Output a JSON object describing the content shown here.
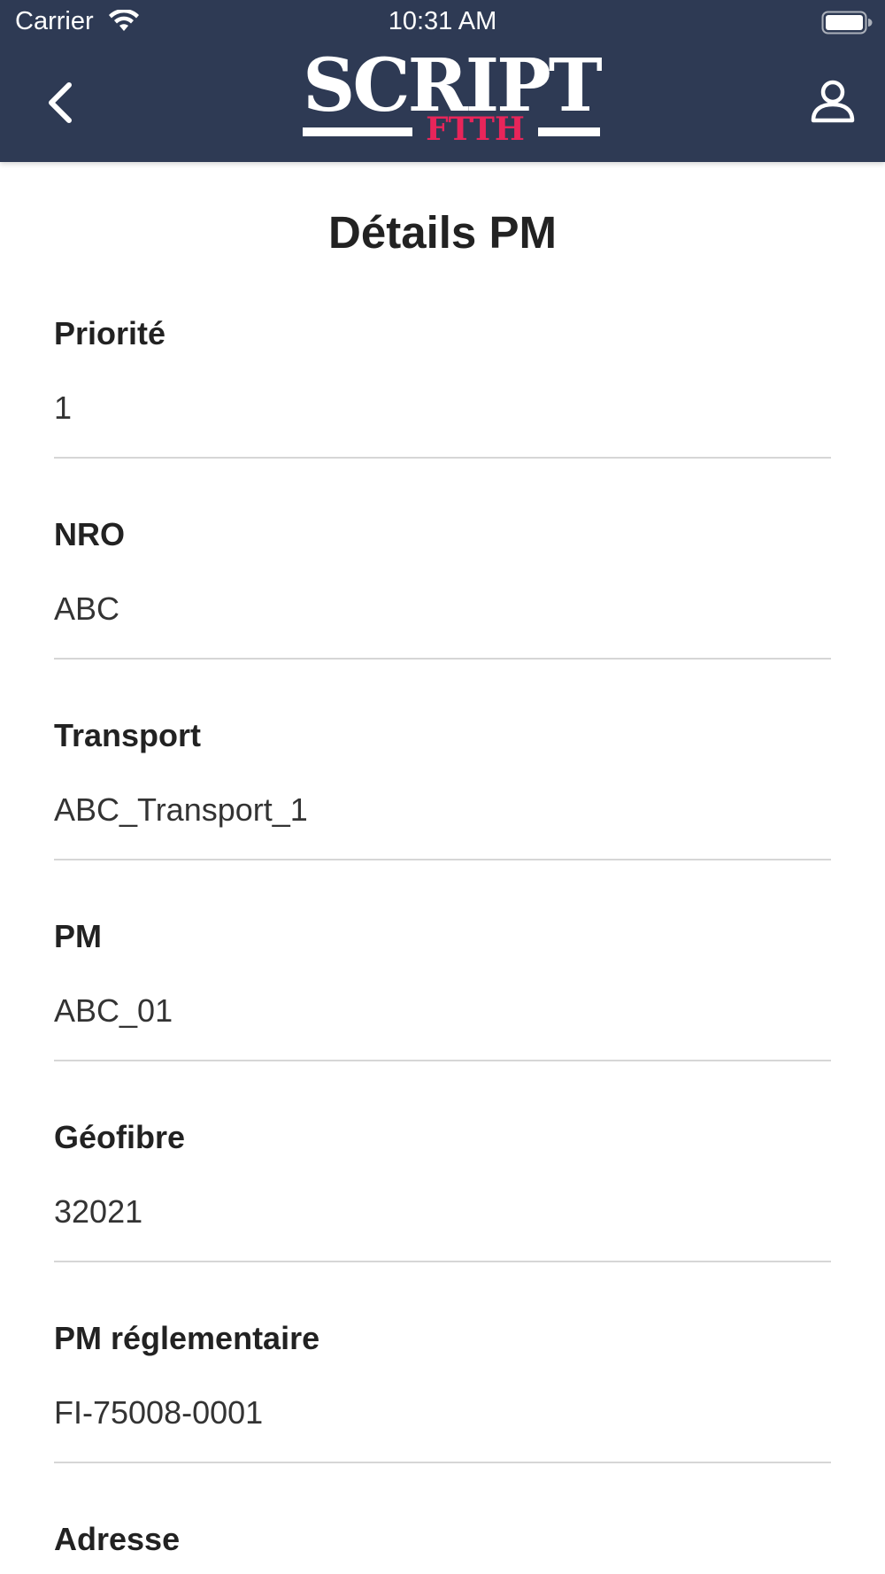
{
  "status_bar": {
    "carrier": "Carrier",
    "time": "10:31 AM"
  },
  "header": {
    "back_icon": "chevron-left-icon",
    "user_icon": "user-icon",
    "logo": {
      "word": "SCRIPT",
      "sub": "FTTH",
      "sub_color": "#e8255a"
    },
    "background": "#2e3a54"
  },
  "main": {
    "title": "Détails PM",
    "fields": [
      {
        "label": "Priorité",
        "value": "1"
      },
      {
        "label": "NRO",
        "value": "ABC"
      },
      {
        "label": "Transport",
        "value": "ABC_Transport_1"
      },
      {
        "label": "PM",
        "value": "ABC_01"
      },
      {
        "label": "Géofibre",
        "value": "32021"
      },
      {
        "label": "PM réglementaire",
        "value": "FI-75008-0001"
      },
      {
        "label": "Adresse",
        "value": ""
      }
    ]
  }
}
